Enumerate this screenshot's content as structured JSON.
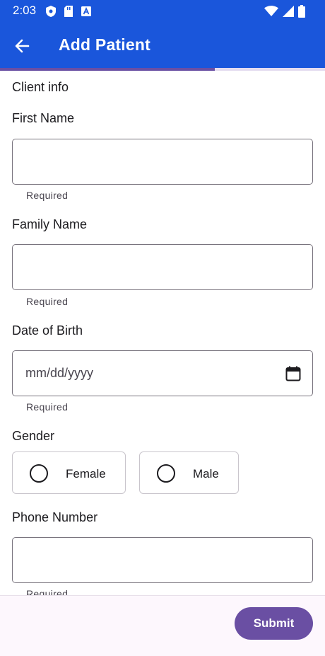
{
  "status_bar": {
    "time": "2:03",
    "left_icons": [
      "shield-icon",
      "sd-card-icon",
      "text-a-icon"
    ],
    "right_icons": [
      "wifi-icon",
      "signal-icon",
      "battery-icon"
    ]
  },
  "app_bar": {
    "title": "Add Patient",
    "back_icon": "arrow-back-icon",
    "color": "#1a56db"
  },
  "progress": {
    "value": 0.66,
    "color": "#6a4fa3"
  },
  "form": {
    "section_title": "Client info",
    "first_name": {
      "label": "First Name",
      "value": "",
      "helper": "Required"
    },
    "family_name": {
      "label": "Family Name",
      "value": "",
      "helper": "Required"
    },
    "dob": {
      "label": "Date of Birth",
      "placeholder": "mm/dd/yyyy",
      "helper": "Required",
      "icon": "calendar-icon"
    },
    "gender": {
      "label": "Gender",
      "options": [
        {
          "label": "Female",
          "selected": false
        },
        {
          "label": "Male",
          "selected": false
        }
      ]
    },
    "phone": {
      "label": "Phone Number",
      "value": "",
      "helper": "Required"
    }
  },
  "footer": {
    "submit_label": "Submit",
    "accent": "#6a4fa3"
  }
}
